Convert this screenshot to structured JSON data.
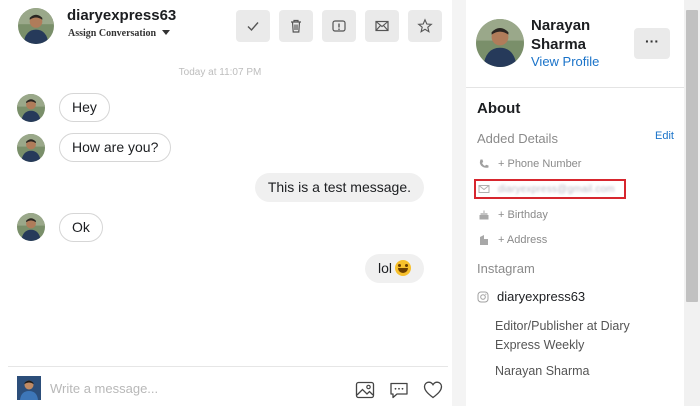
{
  "conversation": {
    "username": "diaryexpress63",
    "assign_label": "Assign Conversation",
    "toolbar": [
      "check-icon",
      "trash-icon",
      "alert-icon",
      "mail-icon",
      "star-icon"
    ],
    "timestamp": "Today at 11:07 PM",
    "messages": [
      {
        "direction": "in",
        "text": "Hey"
      },
      {
        "direction": "in",
        "text": "How are you?"
      },
      {
        "direction": "out",
        "text": "This is a test message."
      },
      {
        "direction": "in",
        "text": "Ok"
      },
      {
        "direction": "out",
        "text": "lol"
      }
    ],
    "composer": {
      "placeholder": "Write a message...",
      "icons": [
        "image-icon",
        "comment-icon",
        "heart-icon"
      ]
    }
  },
  "profile": {
    "name": "Narayan Sharma",
    "view_profile": "View Profile",
    "more_label": "···",
    "about_title": "About",
    "added_details_label": "Added Details",
    "edit_label": "Edit",
    "details": {
      "phone": "+ Phone Number",
      "email": "diaryexpress@gmail.com",
      "birthday": "+ Birthday",
      "address": "+ Address"
    },
    "instagram": {
      "title": "Instagram",
      "handle": "diaryexpress63",
      "bio": "Editor/Publisher at Diary Express Weekly",
      "full_name": "Narayan Sharma"
    }
  },
  "colors": {
    "accent_link": "#1a73c9",
    "highlight_box": "#d7262e",
    "button_bg": "#eaeaea"
  }
}
